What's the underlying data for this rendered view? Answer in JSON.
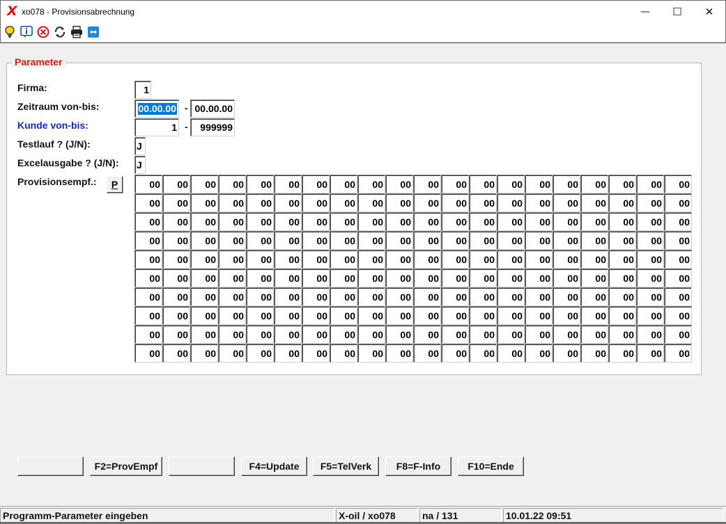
{
  "window": {
    "title": "xo078 - Provisionsabrechnung",
    "logo_text": "X",
    "minimize_glyph": "—",
    "maximize_glyph": "☐",
    "close_glyph": "✕"
  },
  "toolbar": {
    "icons": [
      "lightbulb-icon",
      "info-icon",
      "cancel-icon",
      "refresh-icon",
      "printer-icon",
      "remote-icon"
    ]
  },
  "parameter": {
    "group_title": "Parameter",
    "firma_label": "Firma:",
    "firma_value": "1",
    "zeitraum_label": "Zeitraum von-bis:",
    "zeitraum_von": "00.00.00",
    "zeitraum_bis": "00.00.00",
    "kunde_label": "Kunde von-bis:",
    "kunde_von": "1",
    "kunde_bis": "999999",
    "dash": "-",
    "testlauf_label": "Testlauf ? (J/N):",
    "testlauf_value": "J",
    "excel_label": "Excelausgabe ? (J/N):",
    "excel_value": "J",
    "provisionsempf_label": "Provisionsempf.:",
    "p_button_label": "P",
    "provisionsempf_grid": [
      [
        "00",
        "00",
        "00",
        "00",
        "00",
        "00",
        "00",
        "00",
        "00",
        "00",
        "00",
        "00",
        "00",
        "00",
        "00",
        "00",
        "00",
        "00",
        "00",
        "00"
      ],
      [
        "00",
        "00",
        "00",
        "00",
        "00",
        "00",
        "00",
        "00",
        "00",
        "00",
        "00",
        "00",
        "00",
        "00",
        "00",
        "00",
        "00",
        "00",
        "00",
        "00"
      ],
      [
        "00",
        "00",
        "00",
        "00",
        "00",
        "00",
        "00",
        "00",
        "00",
        "00",
        "00",
        "00",
        "00",
        "00",
        "00",
        "00",
        "00",
        "00",
        "00",
        "00"
      ],
      [
        "00",
        "00",
        "00",
        "00",
        "00",
        "00",
        "00",
        "00",
        "00",
        "00",
        "00",
        "00",
        "00",
        "00",
        "00",
        "00",
        "00",
        "00",
        "00",
        "00"
      ],
      [
        "00",
        "00",
        "00",
        "00",
        "00",
        "00",
        "00",
        "00",
        "00",
        "00",
        "00",
        "00",
        "00",
        "00",
        "00",
        "00",
        "00",
        "00",
        "00",
        "00"
      ],
      [
        "00",
        "00",
        "00",
        "00",
        "00",
        "00",
        "00",
        "00",
        "00",
        "00",
        "00",
        "00",
        "00",
        "00",
        "00",
        "00",
        "00",
        "00",
        "00",
        "00"
      ],
      [
        "00",
        "00",
        "00",
        "00",
        "00",
        "00",
        "00",
        "00",
        "00",
        "00",
        "00",
        "00",
        "00",
        "00",
        "00",
        "00",
        "00",
        "00",
        "00",
        "00"
      ],
      [
        "00",
        "00",
        "00",
        "00",
        "00",
        "00",
        "00",
        "00",
        "00",
        "00",
        "00",
        "00",
        "00",
        "00",
        "00",
        "00",
        "00",
        "00",
        "00",
        "00"
      ],
      [
        "00",
        "00",
        "00",
        "00",
        "00",
        "00",
        "00",
        "00",
        "00",
        "00",
        "00",
        "00",
        "00",
        "00",
        "00",
        "00",
        "00",
        "00",
        "00",
        "00"
      ],
      [
        "00",
        "00",
        "00",
        "00",
        "00",
        "00",
        "00",
        "00",
        "00",
        "00",
        "00",
        "00",
        "00",
        "00",
        "00",
        "00",
        "00",
        "00",
        "00",
        "00"
      ]
    ]
  },
  "function_keys": [
    {
      "label": ""
    },
    {
      "label": "F2=ProvEmpf"
    },
    {
      "label": ""
    },
    {
      "label": "F4=Update"
    },
    {
      "label": "F5=TelVerk"
    },
    {
      "label": "F8=F-Info"
    },
    {
      "label": "F10=Ende"
    }
  ],
  "statusbar": {
    "message": "Programm-Parameter eingeben",
    "app": "X-oil / xo078",
    "user": "na / 131",
    "datetime": "10.01.22 09:51"
  },
  "colors": {
    "group_title": "#d41c10",
    "blue_label": "#1428c8",
    "selection": "#0078d7",
    "logo": "#e01010"
  }
}
